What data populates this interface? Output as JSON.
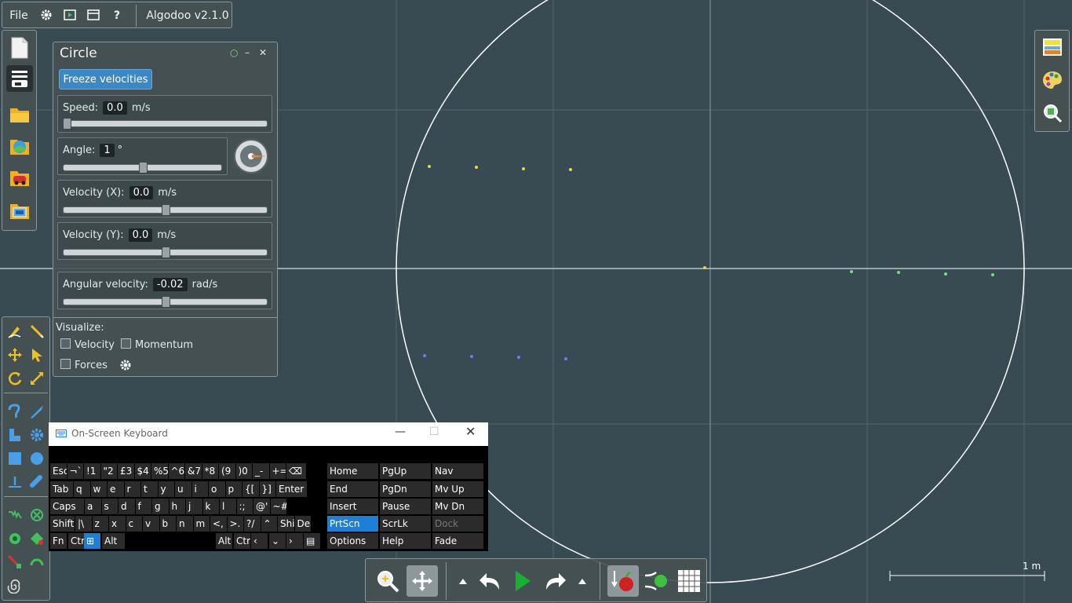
{
  "menu": {
    "file_label": "File",
    "app_title": "Algodoo v2.1.0",
    "icons": [
      "gear-icon",
      "play-scene-icon",
      "window-icon",
      "help-icon"
    ]
  },
  "left_toolbar": {
    "icons": [
      "new-scene-icon",
      "scene-browser-icon",
      "open-folder-icon",
      "algobox-icon",
      "lessons-icon",
      "saved-scenes-icon"
    ]
  },
  "right_toolbar": {
    "icons": [
      "background-icon",
      "palette-icon",
      "zoom-to-scene-icon"
    ]
  },
  "circle_panel": {
    "title": "Circle",
    "freeze_label": "Freeze velocities",
    "speed": {
      "label": "Speed:",
      "value": "0.0",
      "unit": "m/s",
      "slider": 0.0
    },
    "angle": {
      "label": "Angle:",
      "value": "1",
      "unit": "°",
      "slider": 0.5
    },
    "velocity_x": {
      "label": "Velocity (X):",
      "value": "0.0",
      "unit": "m/s",
      "slider": 0.5
    },
    "velocity_y": {
      "label": "Velocity (Y):",
      "value": "0.0",
      "unit": "m/s",
      "slider": 0.5
    },
    "angular_velocity": {
      "label": "Angular velocity:",
      "value": "-0.02",
      "unit": "rad/s",
      "slider": 0.5
    },
    "visualize": {
      "label": "Visualize:",
      "velocity": "Velocity",
      "momentum": "Momentum",
      "forces": "Forces"
    }
  },
  "keyboard": {
    "title": "On-Screen Keyboard",
    "row1": [
      "Esc",
      "¬`",
      "!1",
      "\"2",
      "£3",
      "$4",
      "%5",
      "^6",
      "&7",
      "*8",
      "(9",
      ")0",
      "_-",
      "+=",
      "⌫"
    ],
    "row2": [
      "Tab",
      "q",
      "w",
      "e",
      "r",
      "t",
      "y",
      "u",
      "i",
      "o",
      "p",
      "{[",
      "}]",
      "Enter"
    ],
    "row3": [
      "Caps",
      "a",
      "s",
      "d",
      "f",
      "g",
      "h",
      "j",
      "k",
      "l",
      ":;",
      "@'",
      "~#"
    ],
    "row4": [
      "Shift",
      "|\\",
      "z",
      "x",
      "c",
      "v",
      "b",
      "n",
      "m",
      "<,",
      ">.",
      "?/",
      "^",
      "Shi",
      "Del"
    ],
    "row5": [
      "Fn",
      "Ctr",
      "win",
      "Alt",
      "Alt",
      "Ctr",
      "<",
      "v",
      ">",
      "menu"
    ],
    "nav": [
      [
        "Home",
        "PgUp",
        "Nav"
      ],
      [
        "End",
        "PgDn",
        "Mv Up"
      ],
      [
        "Insert",
        "Pause",
        "Mv Dn"
      ],
      [
        "PrtScn",
        "ScrLk",
        "Dock"
      ],
      [
        "Options",
        "Help",
        "Fade"
      ]
    ]
  },
  "scale_label": "1 m",
  "colors": {
    "accent": "#3b88c4",
    "yellow_dots": "#e8d64a",
    "green_dots": "#6ee08a",
    "blue_dots": "#6f7cf0",
    "play": "#18b030"
  }
}
